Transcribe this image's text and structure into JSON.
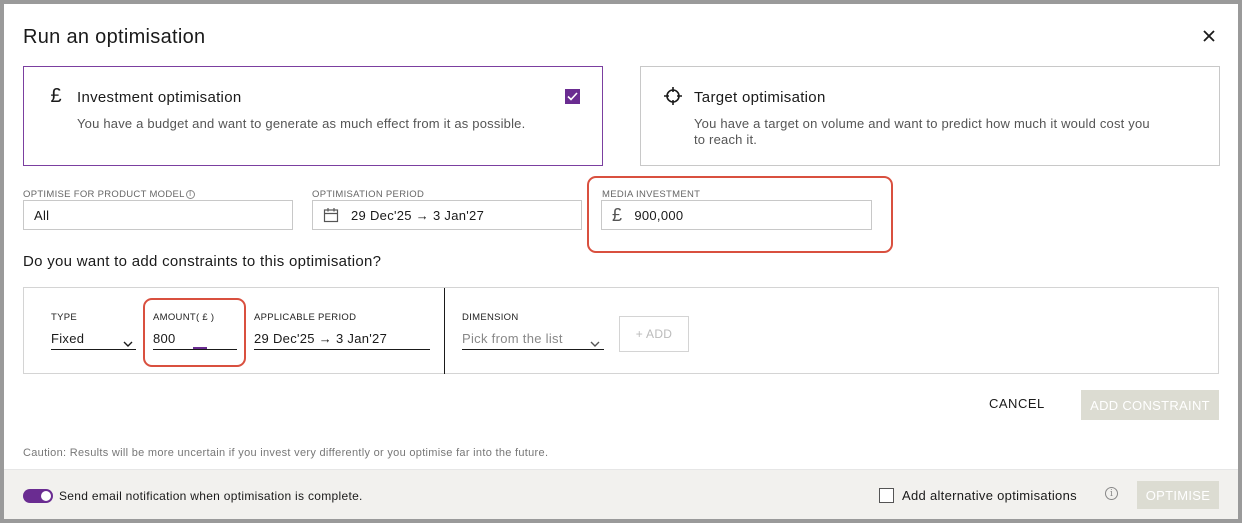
{
  "dialog": {
    "title": "Run an optimisation"
  },
  "cards": [
    {
      "icon": "pound-icon",
      "symbol": "£",
      "title": "Investment optimisation",
      "description": "You have a budget and want to generate as much effect from it as possible.",
      "selected": true
    },
    {
      "icon": "crosshair-icon",
      "title": "Target optimisation",
      "description": "You have a target on volume and want to predict how much it would cost you to reach it.",
      "selected": false
    }
  ],
  "fields": {
    "product_model": {
      "label": "OPTIMISE FOR PRODUCT MODEL",
      "value": "All"
    },
    "period": {
      "label": "OPTIMISATION PERIOD",
      "value": "29 Dec'25 → 3 Jan'27"
    },
    "investment": {
      "label": "MEDIA INVESTMENT",
      "currency": "£",
      "value": "900,000"
    }
  },
  "constraints": {
    "question": "Do you want to add constraints to this optimisation?",
    "type": {
      "label": "TYPE",
      "value": "Fixed"
    },
    "amount": {
      "label": "AMOUNT",
      "currency_suffix": "( £ )",
      "value": "800"
    },
    "applicable_period": {
      "label": "APPLICABLE PERIOD",
      "value": "29 Dec'25 → 3 Jan'27"
    },
    "dimension": {
      "label": "DIMENSION",
      "placeholder": "Pick from the list"
    },
    "add_label": "+ ADD"
  },
  "actions": {
    "cancel": "CANCEL",
    "add_constraint": "ADD CONSTRAINT"
  },
  "caution": "Caution: Results will be more uncertain if you invest very differently or you optimise far into the future.",
  "footer": {
    "email_toggle_label": "Send email notification when optimisation is complete.",
    "email_toggle_on": true,
    "alternative_label": "Add alternative optimisations",
    "optimise": "OPTIMISE"
  },
  "colors": {
    "accent": "#6a2c91",
    "highlight": "#d9503f",
    "disabled": "#dcdcd2"
  }
}
